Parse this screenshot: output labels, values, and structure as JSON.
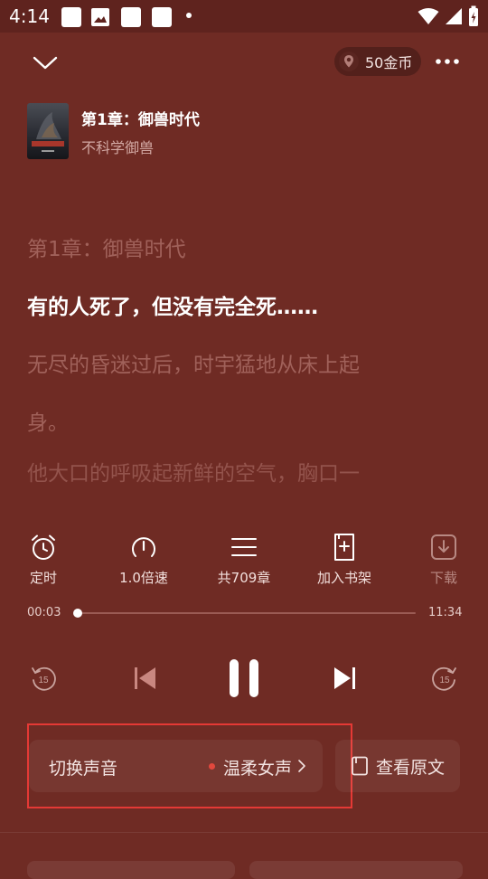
{
  "status_bar": {
    "time": "4:14"
  },
  "top_bar": {
    "coins": "50金币"
  },
  "book": {
    "chapter_title": "第1章：御兽时代",
    "name": "不科学御兽"
  },
  "reading": {
    "lines": [
      "第1章：御兽时代",
      "有的人死了，但没有完全死……",
      "无尽的昏迷过后，时宇猛地从床上起",
      "身。",
      "他大口的呼吸起新鲜的空气，胸口一"
    ],
    "active_line_index": 1
  },
  "tools": [
    {
      "label": "定时",
      "icon": "alarm-clock-icon"
    },
    {
      "label": "1.0倍速",
      "icon": "speedometer-icon"
    },
    {
      "label": "共709章",
      "icon": "list-icon"
    },
    {
      "label": "加入书架",
      "icon": "bookshelf-add-icon"
    },
    {
      "label": "下载",
      "icon": "download-icon"
    }
  ],
  "progress": {
    "current": "00:03",
    "total": "11:34",
    "fraction": 0.004
  },
  "voice": {
    "label": "切换声音",
    "value": "温柔女声"
  },
  "view_original": {
    "label": "查看原文"
  },
  "colors": {
    "background": "#6f2b24",
    "highlight": "#e53935",
    "voice_dot": "#e2483d"
  }
}
